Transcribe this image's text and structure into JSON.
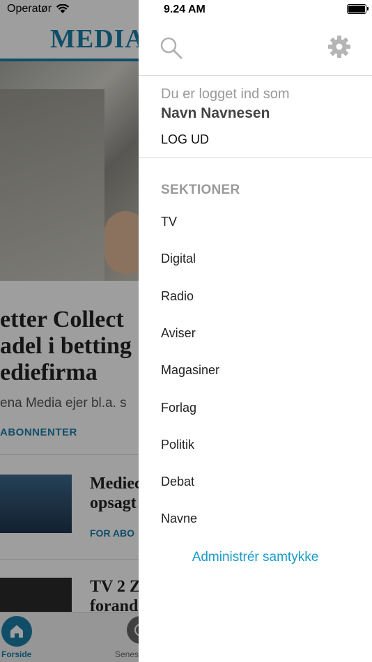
{
  "status_bar": {
    "carrier": "Operatør",
    "time": "9.24 AM"
  },
  "background": {
    "logo_text": "MEDIA",
    "headline_lines": [
      "etter Collect",
      "adel i betting",
      "ediefirma"
    ],
    "subline": "ena Media ejer bl.a. s",
    "subscribe_label": "ABONNENTER",
    "items": [
      {
        "title_lines": [
          "Mediec",
          "opsagt"
        ],
        "badge": "FOR ABO"
      },
      {
        "title_lines": [
          "TV 2 Z",
          "forand"
        ]
      }
    ],
    "tabs": [
      {
        "label": "Forside",
        "icon": "home-icon"
      },
      {
        "label": "Senes",
        "icon": "clock-icon"
      }
    ]
  },
  "drawer": {
    "search_icon": "search-icon",
    "settings_icon": "gear-icon",
    "logged_in_label": "Du er logget ind som",
    "user_name": "Navn Navnesen",
    "logout_label": "LOG UD",
    "sections_header": "SEKTIONER",
    "sections": [
      "TV",
      "Digital",
      "Radio",
      "Aviser",
      "Magasiner",
      "Forlag",
      "Politik",
      "Debat",
      "Navne"
    ],
    "manage_consent_label": "Administrér samtykke",
    "accent_color": "#1a9bc8"
  }
}
